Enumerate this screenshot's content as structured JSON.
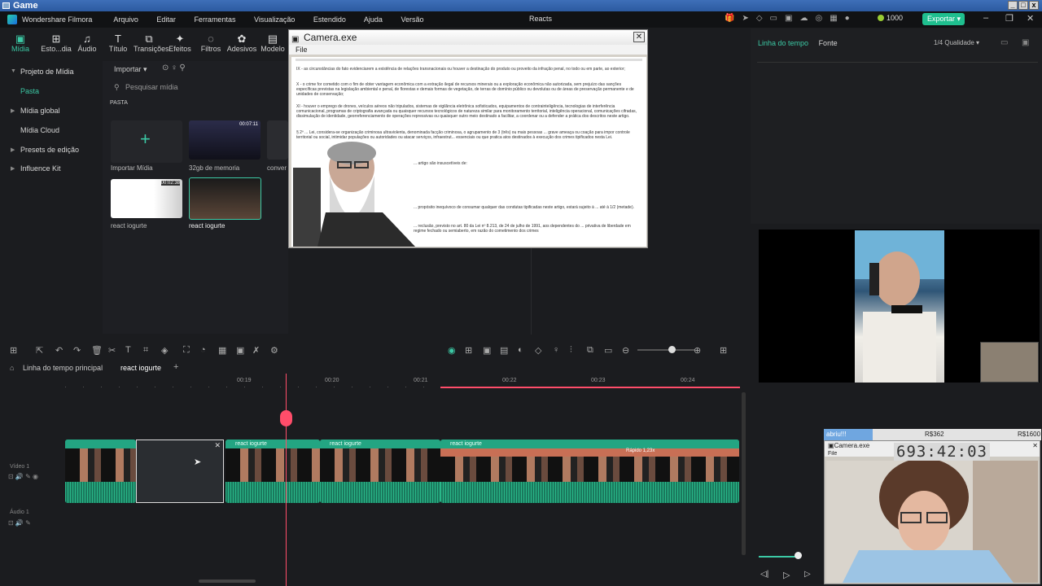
{
  "game_window": {
    "title": "Game"
  },
  "app": {
    "name": "Wondershare Filmora",
    "menu": [
      "Arquivo",
      "Editar",
      "Ferramentas",
      "Visualização",
      "Estendido",
      "Ajuda",
      "Versão"
    ],
    "project_name": "Reacts",
    "credits": "1000",
    "export_label": "Exportar"
  },
  "media_tabs": [
    {
      "label": "Mídia",
      "icon": "media-icon"
    },
    {
      "label": "Esto...dia",
      "icon": "stock-icon"
    },
    {
      "label": "Áudio",
      "icon": "music-icon"
    },
    {
      "label": "Título",
      "icon": "text-icon"
    },
    {
      "label": "Transições",
      "icon": "transition-icon"
    },
    {
      "label": "Efeitos",
      "icon": "effects-icon"
    },
    {
      "label": "Filtros",
      "icon": "filter-icon"
    },
    {
      "label": "Adesivos",
      "icon": "sticker-icon"
    },
    {
      "label": "Modelo",
      "icon": "template-icon"
    }
  ],
  "left_nav": {
    "project": "Projeto de Mídia",
    "folder": "Pasta",
    "items": [
      "Mídia global",
      "Mídia Cloud",
      "Presets de edição",
      "Influence Kit"
    ]
  },
  "media": {
    "import_label": "Importar",
    "search_placeholder": "Pesquisar mídia",
    "section": "PASTA",
    "items": [
      {
        "label": "Importar Mídia"
      },
      {
        "label": "32gb de memoria",
        "duration": "00:07:11"
      },
      {
        "label": "conver"
      },
      {
        "label": "react iogurte",
        "duration": "00:02:38"
      },
      {
        "label": "react iogurte"
      }
    ]
  },
  "camera_window": {
    "title": "Camera.exe",
    "menu": "File",
    "doc_paragraphs": [
      "IX - as circunstâncias do fato evidenciarem a existência de relações transnacionais ou houver a destinação do produto ou proveito da infração penal, no todo ou em parte, ao exterior;",
      "X - o crime for cometido com o fim de obter vantagem econômica com a extração ilegal de recursos minerais ou a exploração econômica não autorizada, sem prejuízo das sanções específicas previstas na legislação ambiental e penal, de florestas e demais formas de vegetação, de terras de domínio público ou devolutas ou de áreas de preservação permanente e de unidades de conservação;",
      "XI - houver o emprego de drones, veículos aéreos não tripulados, sistemas de vigilância eletrônica sofisticados, equipamentos de contrainteligência, tecnologias de interferência comunicacional, programas de criptografia avançada ou quaisquer recursos tecnológicos de natureza similar para monitoramento territorial, inteligência operacional, comunicações cifradas, dissimulação de identidade, georreferenciamento de operações repressivas ou quaisquer outro meio destinado a facilitar, a coordenar ou a defender a prática dos descritos neste artigo.",
      "§ 2º ... Lei, considera-se organização criminosa ultraviolenta, denominada facção criminosa, o agrupamento de 3 (três) ou mais pessoas ... grave ameaça ou coação para impor controle territorial ou social, intimidar populações ou autoridades ou atacar serviços, infraestrut... essenciais ou que pratica atos destinados à execução dos crimes tipificados nesta Lei.",
      "... artigo são insuscetíveis de:",
      "... propósito inequívoco de consumar qualquer das condutas tipificadas neste artigo, estará sujeito à ... até à 1/2 (metade).",
      "... reclusão, previsto no art. 80 da Lei nº 8.213, de 24 de julho de 1991, aos dependentes do ... privativa de liberdade em regime fechado ou semiaberto, em razão do cometimento dos crimes"
    ]
  },
  "right_panel": {
    "tabs": [
      "Linha do tempo",
      "Fonte"
    ],
    "quality": "1/4 Qualidade"
  },
  "timeline": {
    "tabs": [
      "Linha do tempo principal",
      "react iogurte"
    ],
    "ticks": [
      "00:19",
      "00:20",
      "00:21",
      "00:22",
      "00:23",
      "00:24"
    ],
    "tracks": [
      "Vídeo 1",
      "Áudio 1"
    ],
    "clips": [
      "react iogurte",
      "react iogurte",
      "react iogurte"
    ],
    "speed_label": "Rápido 1,23x"
  },
  "subs_overlay": {
    "goal_label": "abriu!!!",
    "mid": "R$362",
    "right": "R$1600"
  },
  "cam2": {
    "title": "Camera.exe",
    "menu": "File",
    "timer": "693:42:03"
  },
  "colors": {
    "accent": "#3cc9a5",
    "playhead": "#ff4d6a",
    "clip": "#23a582"
  }
}
